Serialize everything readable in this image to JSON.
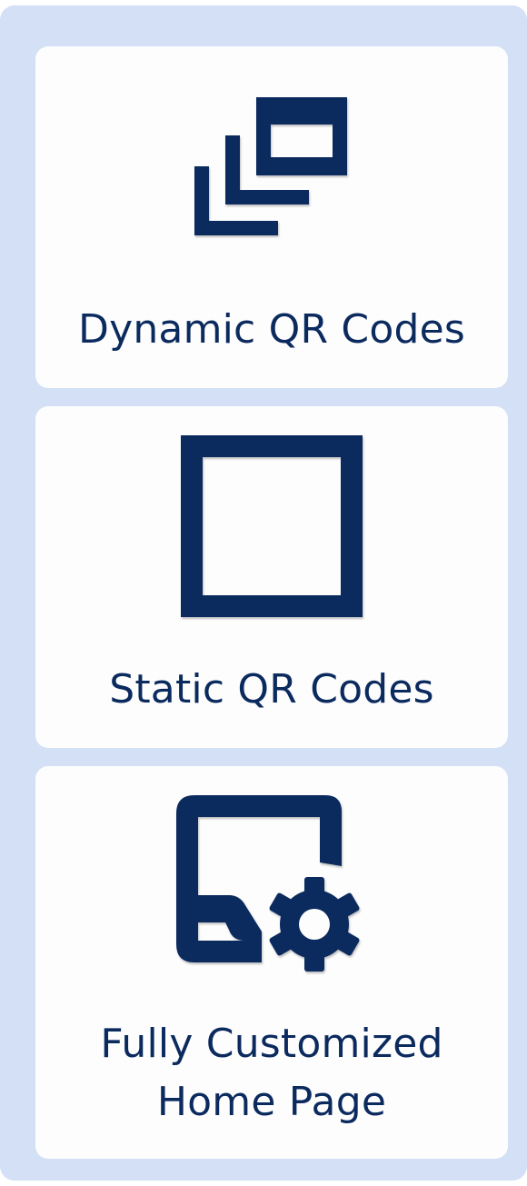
{
  "colors": {
    "panel_background": "#d3e0f5",
    "card_background": "#fdfdfe",
    "primary": "#0b2a5e"
  },
  "features": [
    {
      "label": "Dynamic QR Codes",
      "icon": "stacked-windows-icon"
    },
    {
      "label": "Static QR Codes",
      "icon": "square-outline-icon"
    },
    {
      "label": "Fully Customized\nHome Page",
      "icon": "page-settings-icon"
    }
  ]
}
